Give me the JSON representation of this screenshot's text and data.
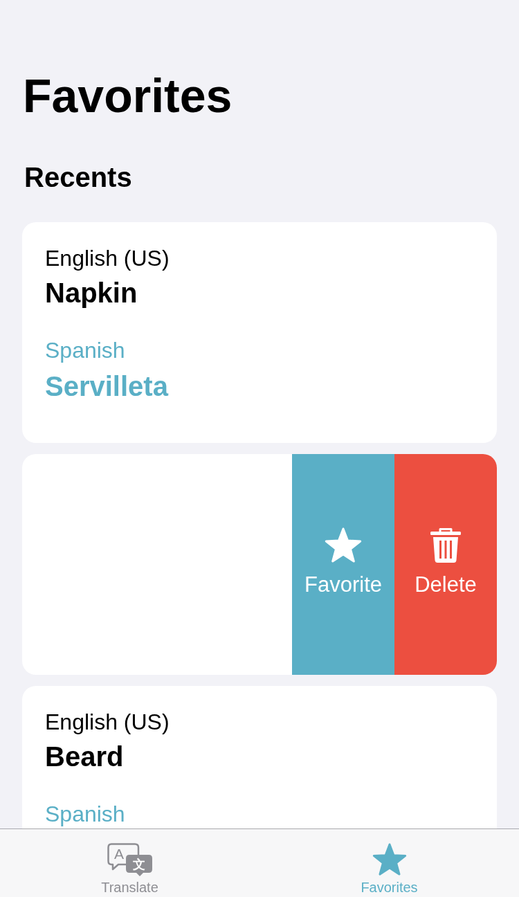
{
  "screen": {
    "title": "Favorites",
    "section_title": "Recents"
  },
  "recents": [
    {
      "kind": "translation",
      "source_language": "English (US)",
      "source_text": "Napkin",
      "target_language": "Spanish",
      "target_text": "Servilleta"
    },
    {
      "kind": "swiped",
      "actions": [
        {
          "kind": "favorite",
          "label": "Favorite"
        },
        {
          "kind": "delete",
          "label": "Delete"
        }
      ]
    },
    {
      "kind": "translation",
      "source_language": "English (US)",
      "source_text": "Beard",
      "target_language": "Spanish"
    }
  ],
  "tab_bar": {
    "tabs": [
      {
        "kind": "translate",
        "label": "Translate",
        "icon_letters": [
          "A",
          "文"
        ],
        "selected": false
      },
      {
        "kind": "favorites",
        "label": "Favorites",
        "selected": true
      }
    ]
  }
}
